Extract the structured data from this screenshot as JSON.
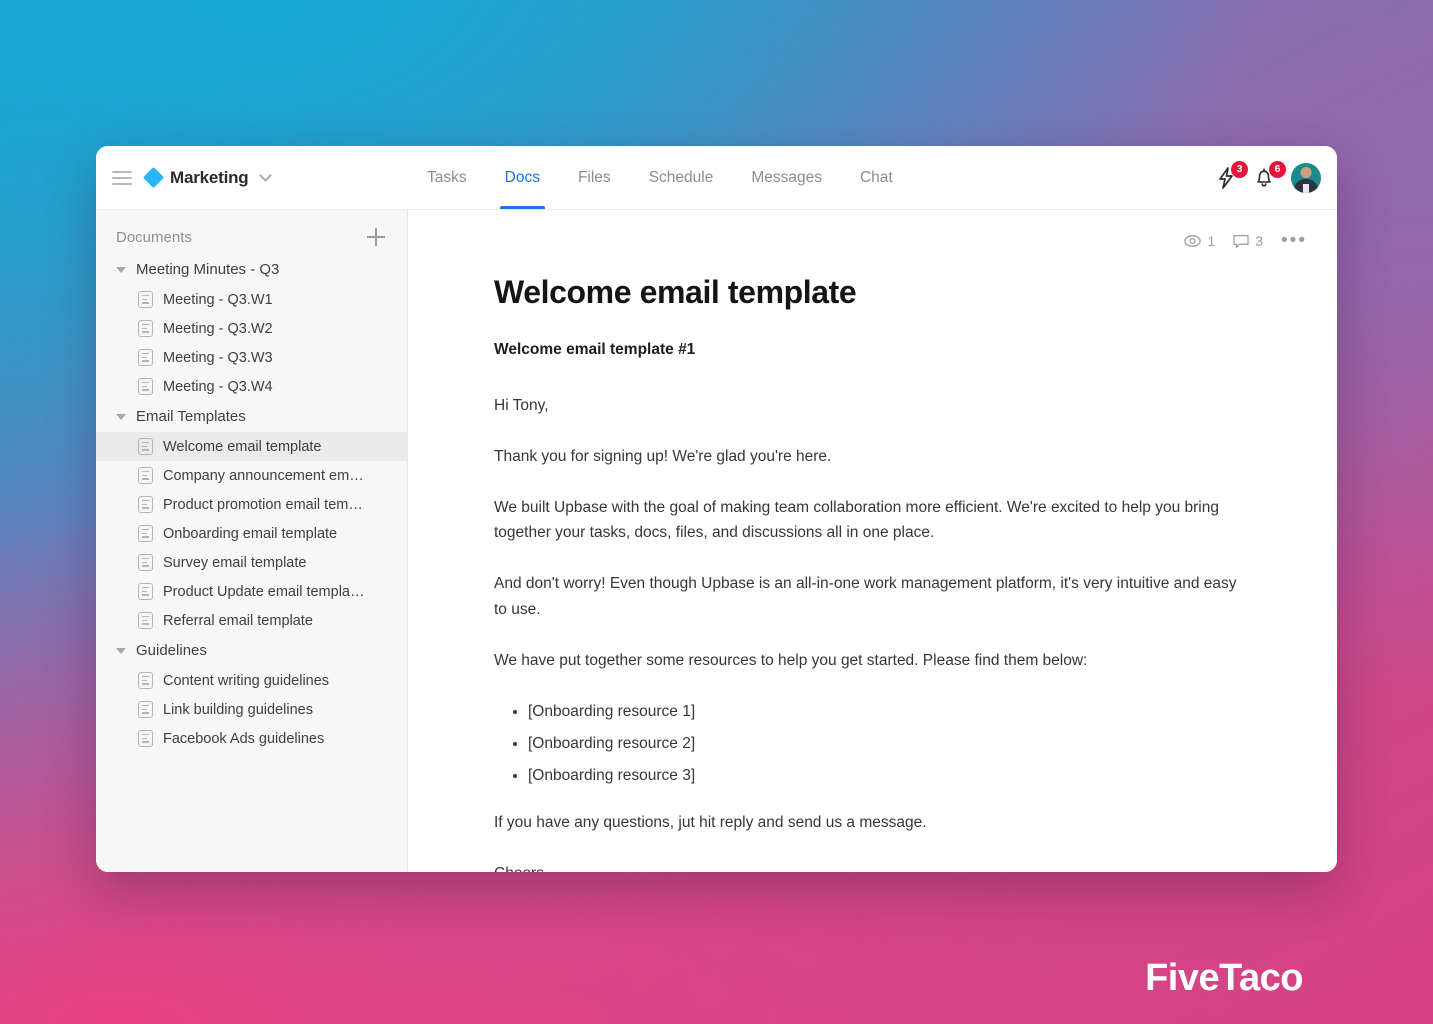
{
  "topbar": {
    "menu_icon": "hamburger-icon",
    "workspace": "Marketing",
    "workspace_chevron": "chevron-down-icon",
    "tabs": [
      {
        "label": "Tasks",
        "active": false
      },
      {
        "label": "Docs",
        "active": true
      },
      {
        "label": "Files",
        "active": false
      },
      {
        "label": "Schedule",
        "active": false
      },
      {
        "label": "Messages",
        "active": false
      },
      {
        "label": "Chat",
        "active": false
      }
    ],
    "actions": {
      "bolt_icon": "lightning-bolt-icon",
      "bolt_badge": "3",
      "bell_icon": "bell-icon",
      "bell_badge": "6",
      "avatar": "user-avatar"
    }
  },
  "sidebar": {
    "title": "Documents",
    "add_icon": "plus-icon",
    "groups": [
      {
        "label": "Meeting Minutes - Q3",
        "expanded": true,
        "items": [
          {
            "label": "Meeting - Q3.W1",
            "selected": false
          },
          {
            "label": "Meeting - Q3.W2",
            "selected": false
          },
          {
            "label": "Meeting - Q3.W3",
            "selected": false
          },
          {
            "label": "Meeting - Q3.W4",
            "selected": false
          }
        ]
      },
      {
        "label": "Email Templates",
        "expanded": true,
        "items": [
          {
            "label": "Welcome email template",
            "selected": true
          },
          {
            "label": "Company announcement em…",
            "selected": false
          },
          {
            "label": "Product promotion email tem…",
            "selected": false
          },
          {
            "label": "Onboarding email template",
            "selected": false
          },
          {
            "label": "Survey email template",
            "selected": false
          },
          {
            "label": "Product Update email templa…",
            "selected": false
          },
          {
            "label": "Referral email template",
            "selected": false
          }
        ]
      },
      {
        "label": "Guidelines",
        "expanded": true,
        "items": [
          {
            "label": "Content writing guidelines",
            "selected": false
          },
          {
            "label": "Link building guidelines",
            "selected": false
          },
          {
            "label": "Facebook Ads guidelines",
            "selected": false
          }
        ]
      }
    ]
  },
  "content": {
    "toolbar": {
      "views_icon": "eye-icon",
      "views_count": "1",
      "comments_icon": "comment-icon",
      "comments_count": "3",
      "more_icon": "ellipsis-icon",
      "more_label": "•••"
    },
    "title": "Welcome email template",
    "subtitle": "Welcome email template #1",
    "paragraphs": [
      "Hi Tony,",
      "Thank you for signing up! We're glad you're here.",
      "We built Upbase with the goal of making team collaboration more efficient. We're excited to help you bring together your tasks, docs, files, and discussions all in one place.",
      "And don't worry! Even though Upbase is an all-in-one work management platform, it's very intuitive and easy to use.",
      "We have put together some resources to help you get started. Please find them below:"
    ],
    "list": [
      "[Onboarding resource 1]",
      "[Onboarding resource 2]",
      "[Onboarding resource 3]"
    ],
    "closing": [
      "If you have any questions, jut hit reply and send us a message.",
      "Cheers,"
    ]
  },
  "brand": {
    "name": "FiveTaco"
  },
  "colors": {
    "accent_blue": "#1a73e8",
    "workspace_diamond": "#29b6f6",
    "badge_red": "#e8123c",
    "sidebar_bg": "#f7f7f7",
    "selected_bg": "#ebebeb",
    "gradient_top_left": "#1aa5d0",
    "gradient_top_right": "#8c68a8",
    "gradient_bottom_left": "#e33f7e",
    "gradient_bottom_right": "#d44183"
  }
}
